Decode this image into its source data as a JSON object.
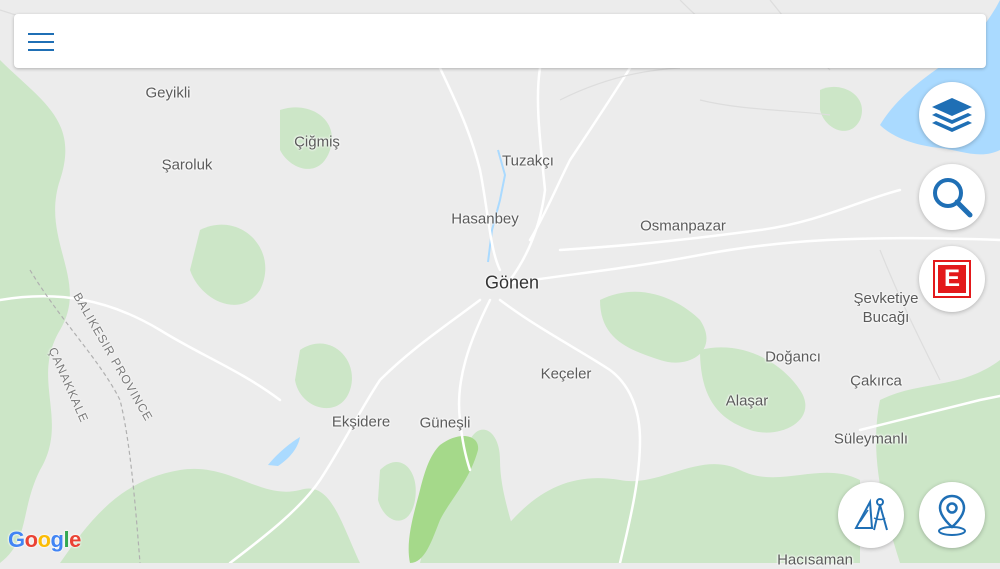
{
  "map": {
    "places": [
      {
        "id": "geyikli",
        "label": "Geyikli"
      },
      {
        "id": "cigmis",
        "label": "Çiğmiş"
      },
      {
        "id": "saroluk",
        "label": "Şaroluk"
      },
      {
        "id": "tuzakci",
        "label": "Tuzakçı"
      },
      {
        "id": "hasanbey",
        "label": "Hasanbey"
      },
      {
        "id": "osmanpazar",
        "label": "Osmanpazar"
      },
      {
        "id": "gonen",
        "label": "Gönen"
      },
      {
        "id": "sevketiye-line1",
        "label": "Şevketiye"
      },
      {
        "id": "sevketiye-line2",
        "label": "Bucağı"
      },
      {
        "id": "dogan",
        "label": "Doğancı"
      },
      {
        "id": "keceler",
        "label": "Keçeler"
      },
      {
        "id": "cakirca",
        "label": "Çakırca"
      },
      {
        "id": "alasar",
        "label": "Alaşar"
      },
      {
        "id": "eksidere",
        "label": "Ekşidere"
      },
      {
        "id": "guneşli",
        "label": "Güneşli"
      },
      {
        "id": "suleymanli",
        "label": "Süleymanlı"
      },
      {
        "id": "hacisaman",
        "label": "Hacısaman"
      }
    ],
    "boundary_labels": {
      "balikesir": "BALIKESIR PROVINCE",
      "canakkale": "ÇANAKKALE"
    },
    "attribution": "Google"
  },
  "toolbar": {
    "menu_icon": "hamburger-icon"
  },
  "buttons": {
    "layers_icon": "layers-icon",
    "search_icon": "search-icon",
    "e_label": "E",
    "measure_icon": "drafting-compass-icon",
    "location_icon": "map-pin-icon"
  },
  "colors": {
    "accent": "#1f6fb5",
    "water": "#aadaff",
    "forest": "#c4e3c0",
    "park": "#a5d98a",
    "land": "#ececec",
    "badge_red": "#e3191b"
  }
}
